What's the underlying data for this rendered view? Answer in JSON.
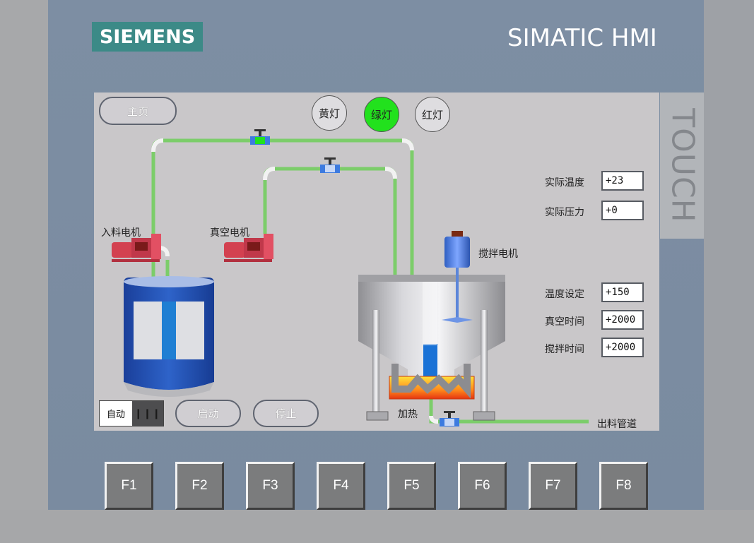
{
  "device": {
    "logo": "SIEMENS",
    "brand": "SIMATIC HMI",
    "touch_label": "TOUCH",
    "function_keys": [
      "F1",
      "F2",
      "F3",
      "F4",
      "F5",
      "F6",
      "F7",
      "F8"
    ]
  },
  "screen": {
    "home_button": "主页",
    "lamps": [
      {
        "label": "黄灯",
        "state": "off"
      },
      {
        "label": "绿灯",
        "state": "on",
        "color": "#22e11d"
      },
      {
        "label": "红灯",
        "state": "off"
      }
    ],
    "equipment": {
      "feed_motor": "入料电机",
      "vacuum_motor": "真空电机",
      "mixer_motor": "搅拌电机",
      "heating": "加热",
      "outlet_pipe": "出料管道"
    },
    "readouts": {
      "actual_temp_label": "实际温度",
      "actual_temp_value": "+23",
      "actual_pressure_label": "实际压力",
      "actual_pressure_value": "+0"
    },
    "settings": {
      "temp_setpoint_label": "温度设定",
      "temp_setpoint_value": "+150",
      "vacuum_time_label": "真空时间",
      "vacuum_time_value": "+2000",
      "mix_time_label": "搅拌时间",
      "mix_time_value": "+2000"
    },
    "mode_switch": {
      "label": "自动",
      "icon": "switch-grip-icon"
    },
    "start_button": "启动",
    "stop_button": "停止"
  },
  "colors": {
    "pipe": "#7ccd6a",
    "lamp_on": "#22e11d",
    "tank_blue": "#1f52b4",
    "pump_red": "#d34150"
  }
}
